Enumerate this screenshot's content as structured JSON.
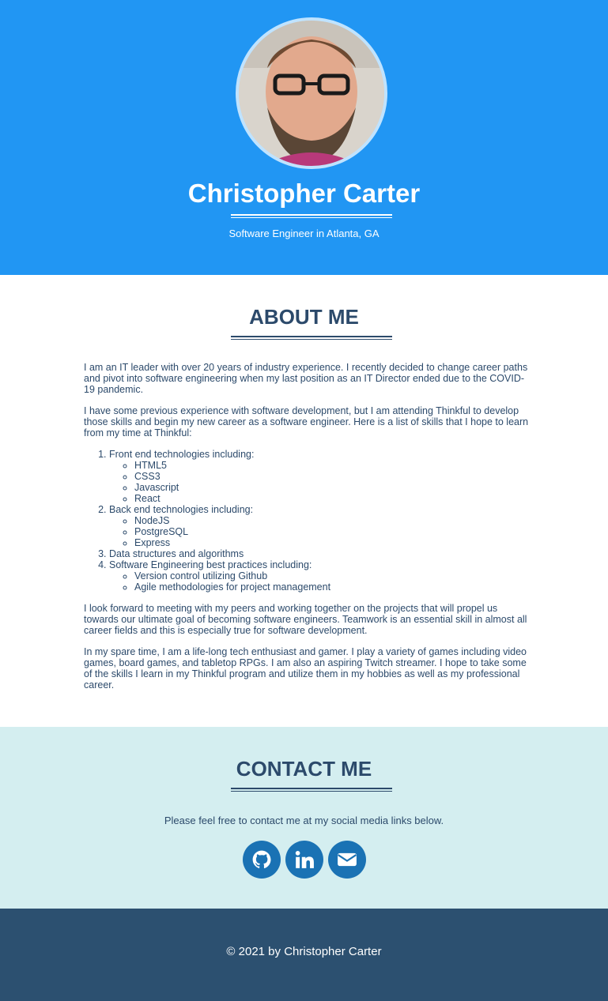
{
  "header": {
    "name": "Christopher Carter",
    "subtitle": "Software Engineer in Atlanta, GA",
    "bg_color": "#2196f3"
  },
  "about": {
    "title": "ABOUT ME",
    "p1": "I am an IT leader with over 20 years of industry experience. I recently decided to change career paths and pivot into software engineering when my last position as an IT Director ended due to the COVID-19 pandemic.",
    "p2": "I have some previous experience with software development, but I am attending Thinkful to develop those skills and begin my new career as a software engineer. Here is a list of skills that I hope to learn from my time at Thinkful:",
    "skills": [
      {
        "label": "Front end technologies including:",
        "items": [
          "HTML5",
          "CSS3",
          "Javascript",
          "React"
        ]
      },
      {
        "label": "Back end technologies including:",
        "items": [
          "NodeJS",
          "PostgreSQL",
          "Express"
        ]
      },
      {
        "label": "Data structures and algorithms",
        "items": []
      },
      {
        "label": "Software Engineering best practices including:",
        "items": [
          "Version control utilizing Github",
          "Agile methodologies for project management"
        ]
      }
    ],
    "p3": "I look forward to meeting with my peers and working together on the projects that will propel us towards our ultimate goal of becoming software engineers. Teamwork is an essential skill in almost all career fields and this is especially true for software development.",
    "p4": "In my spare time, I am a life-long tech enthusiast and gamer. I play a variety of games including video games, board games, and tabletop RPGs. I am also an aspiring Twitch streamer. I hope to take some of the skills I learn in my Thinkful program and utilize them in my hobbies as well as my professional career."
  },
  "contact": {
    "title": "CONTACT ME",
    "text": "Please feel free to contact me at my social media links below.",
    "socials": [
      "github-icon",
      "linkedin-icon",
      "envelope-icon"
    ],
    "bg_color": "#d4eef0"
  },
  "footer": {
    "text": "© 2021 by Christopher Carter",
    "bg_color": "#2c5070"
  }
}
